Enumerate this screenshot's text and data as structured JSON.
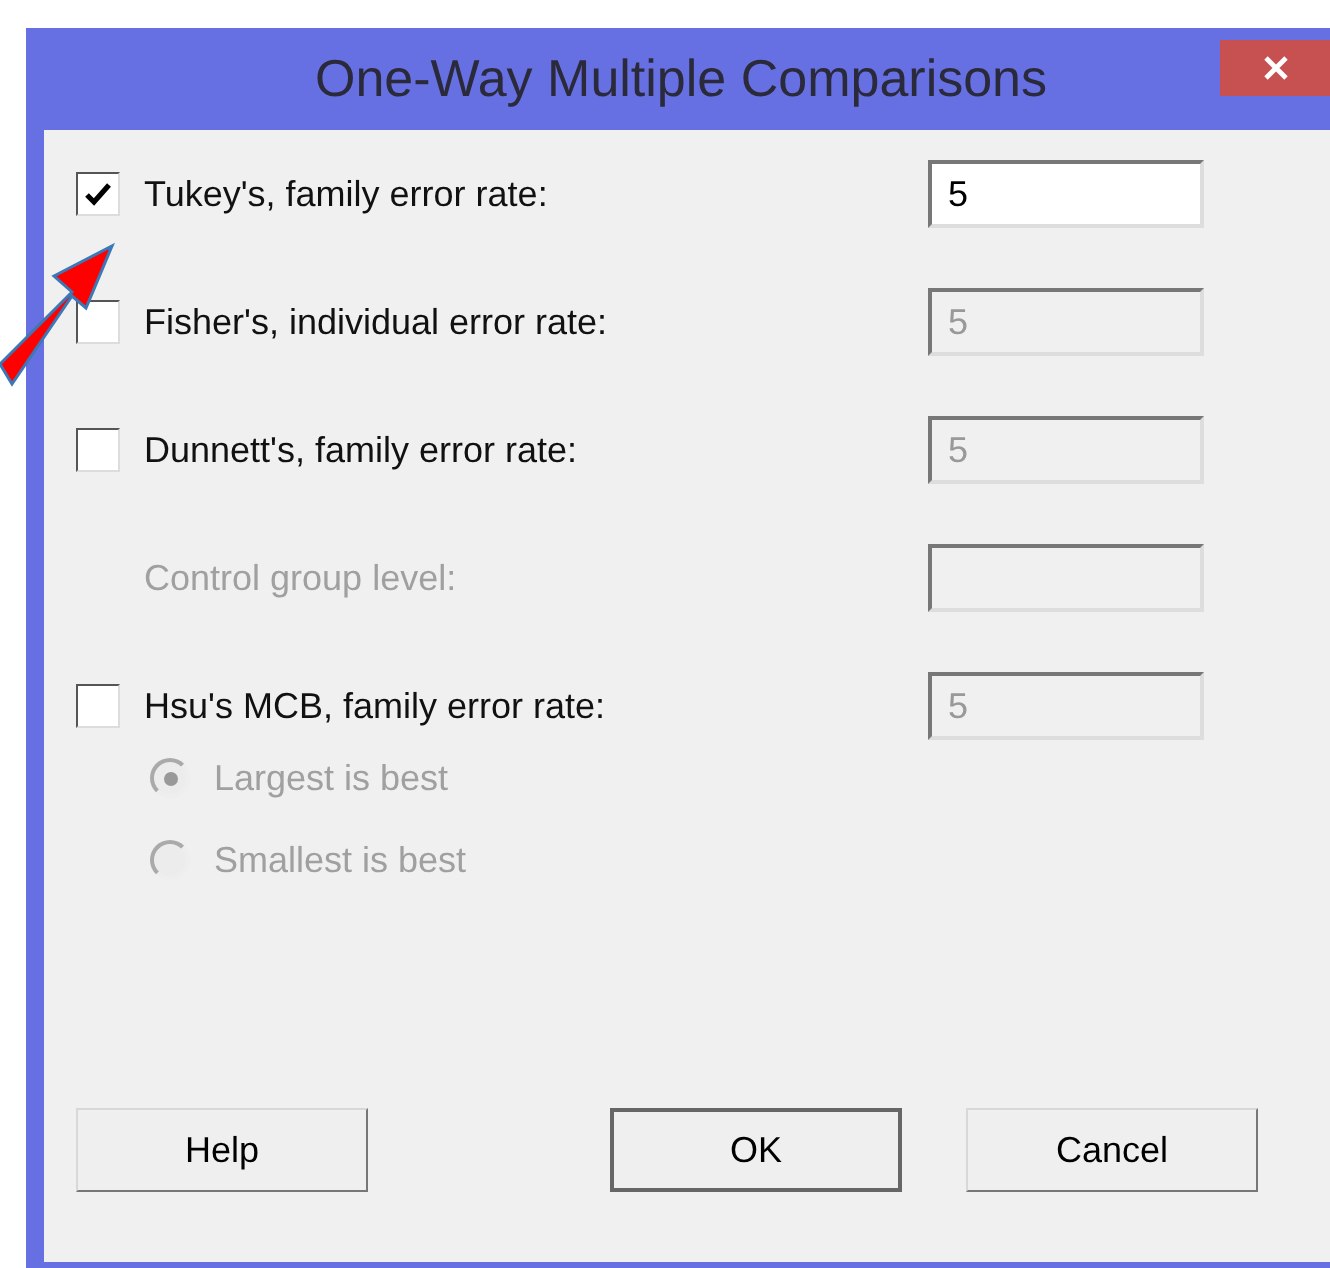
{
  "window": {
    "title": "One-Way Multiple Comparisons"
  },
  "options": [
    {
      "kind": "checkbox",
      "label": "Tukey's, family error rate:",
      "checked": true,
      "disabled": false,
      "field": {
        "value": "5",
        "disabled": false
      }
    },
    {
      "kind": "checkbox",
      "label": "Fisher's, individual error rate:",
      "checked": false,
      "disabled": false,
      "field": {
        "value": "5",
        "disabled": true
      }
    },
    {
      "kind": "checkbox",
      "label": "Dunnett's, family error rate:",
      "checked": false,
      "disabled": false,
      "field": {
        "value": "5",
        "disabled": true
      }
    },
    {
      "kind": "label",
      "label": "Control group level:",
      "disabled": true,
      "field": {
        "disabled": true
      }
    },
    {
      "kind": "checkbox",
      "label": "Hsu's MCB, family error rate:",
      "checked": false,
      "disabled": false,
      "field": {
        "value": "5",
        "disabled": true
      }
    }
  ],
  "radios": [
    {
      "label": "Largest is best",
      "selected": true,
      "disabled": true
    },
    {
      "label": "Smallest is best",
      "selected": false,
      "disabled": true
    }
  ],
  "buttons": [
    {
      "label": "Help",
      "default": false
    },
    {
      "label": "OK",
      "default": true
    },
    {
      "label": "Cancel",
      "default": false
    }
  ]
}
